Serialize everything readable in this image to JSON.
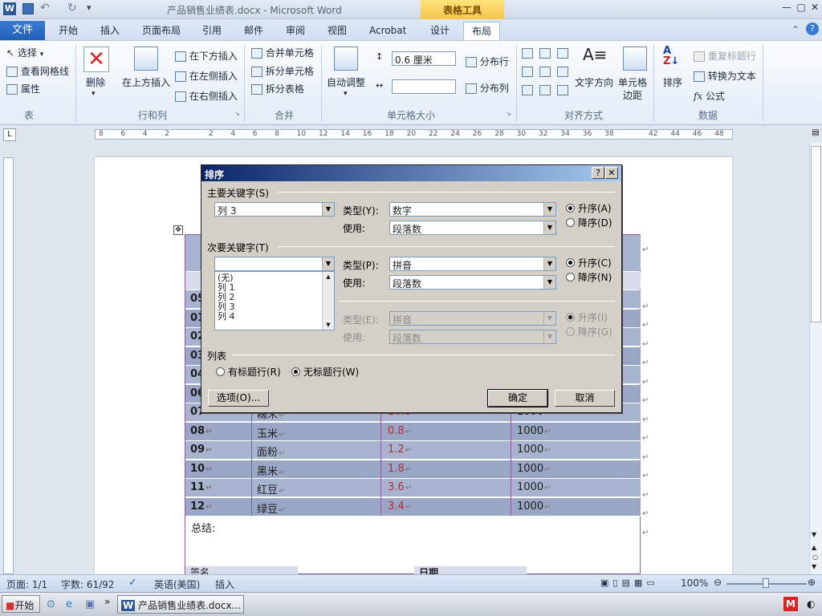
{
  "window": {
    "title": "产品销售业绩表.docx - Microsoft Word",
    "context_tab": "表格工具",
    "controls": [
      "—",
      "▢",
      "✕"
    ]
  },
  "ribbon_tabs": [
    "文件",
    "开始",
    "插入",
    "页面布局",
    "引用",
    "邮件",
    "审阅",
    "视图",
    "Acrobat",
    "设计",
    "布局"
  ],
  "active_tab": "布局",
  "ribbon": {
    "table": {
      "select": "选择",
      "gridlines": "查看网格线",
      "properties": "属性",
      "label": "表"
    },
    "rows_cols": {
      "delete": "删除",
      "insert_above": "在上方插入",
      "insert_below": "在下方插入",
      "insert_left": "在左侧插入",
      "insert_right": "在右侧插入",
      "label": "行和列"
    },
    "merge": {
      "merge_cells": "合并单元格",
      "split_cells": "拆分单元格",
      "split_table": "拆分表格",
      "label": "合并"
    },
    "cell_size": {
      "autofit": "自动调整",
      "height_value": "0.6 厘米",
      "distribute_rows": "分布行",
      "distribute_cols": "分布列",
      "label": "单元格大小"
    },
    "alignment": {
      "text_direction": "文字方向",
      "cell_margins_1": "单元格",
      "cell_margins_2": "边距",
      "label": "对齐方式"
    },
    "data": {
      "sort": "排序",
      "repeat_header": "重复标题行",
      "convert_text": "转换为文本",
      "formula": "公式",
      "label": "数据"
    }
  },
  "ruler": {
    "numbers": [
      "8",
      "6",
      "4",
      "2",
      "",
      "2",
      "4",
      "6",
      "8",
      "10",
      "12",
      "14",
      "16",
      "18",
      "20",
      "22",
      "24",
      "26",
      "28",
      "30",
      "32",
      "34",
      "36",
      "38",
      "",
      "42",
      "44",
      "46",
      "48"
    ]
  },
  "table_rows": [
    {
      "id": "05",
      "name": "",
      "price": "",
      "qty": ""
    },
    {
      "id": "01",
      "name": "",
      "price": "",
      "qty": ""
    },
    {
      "id": "02",
      "name": "",
      "price": "",
      "qty": ""
    },
    {
      "id": "03",
      "name": "",
      "price": "",
      "qty": ""
    },
    {
      "id": "04",
      "name": "",
      "price": "",
      "qty": ""
    },
    {
      "id": "06",
      "name": "",
      "price": "",
      "qty": ""
    },
    {
      "id": "07",
      "name": "糯米",
      "price": "10.8",
      "qty": "1000"
    },
    {
      "id": "08",
      "name": "玉米",
      "price": "0.8",
      "qty": "1000"
    },
    {
      "id": "09",
      "name": "面粉",
      "price": "1.2",
      "qty": "1000"
    },
    {
      "id": "10",
      "name": "黑米",
      "price": "1.8",
      "qty": "1000"
    },
    {
      "id": "11",
      "name": "红豆",
      "price": "3.6",
      "qty": "1000"
    },
    {
      "id": "12",
      "name": "绿豆",
      "price": "3.4",
      "qty": "1000"
    }
  ],
  "doc": {
    "summary": "总结:",
    "signature": "签名",
    "date": "日期",
    "partial_label": "第"
  },
  "sort_dialog": {
    "title": "排序",
    "help": "?",
    "close": "✕",
    "primary_key_label": "主要关键字(S)",
    "primary_key_value": "列 3",
    "primary_type_label": "类型(Y):",
    "primary_type_value": "数字",
    "primary_use_label": "使用:",
    "primary_use_value": "段落数",
    "asc_a": "升序(A)",
    "desc_d": "降序(D)",
    "secondary_key_label": "次要关键字(T)",
    "secondary_key_value": "",
    "secondary_type_label": "类型(P):",
    "secondary_type_value": "拼音",
    "secondary_use_label": "使用:",
    "secondary_use_value": "段落数",
    "asc_c": "升序(C)",
    "desc_n": "降序(N)",
    "list_options": [
      "(无)",
      "列 1",
      "列 2",
      "列 3",
      "列 4"
    ],
    "third_type_label": "类型(E):",
    "third_type_value": "拼音",
    "third_use_label": "使用:",
    "third_use_value": "段落数",
    "asc_i": "升序(I)",
    "desc_g": "降序(G)",
    "list_label": "列表",
    "has_header": "有标题行(R)",
    "no_header": "无标题行(W)",
    "options_btn": "选项(O)...",
    "ok_btn": "确定",
    "cancel_btn": "取消"
  },
  "status": {
    "page": "页面: 1/1",
    "words": "字数: 61/92",
    "lang": "英语(美国)",
    "mode": "插入",
    "zoom": "100%"
  },
  "taskbar": {
    "start": "开始",
    "task": "产品销售业绩表.docx..."
  }
}
